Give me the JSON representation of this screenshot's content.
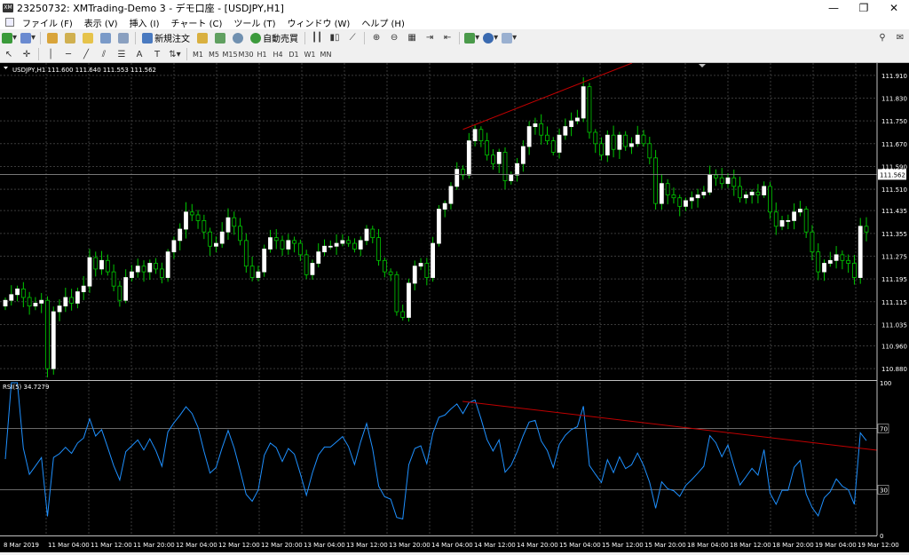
{
  "window": {
    "title": "23250732: XMTrading-Demo 3 - デモ口座 - [USDJPY,H1]",
    "app_icon_label": "XM"
  },
  "menu": {
    "items": [
      "ファイル (F)",
      "表示 (V)",
      "挿入 (I)",
      "チャート (C)",
      "ツール (T)",
      "ウィンドウ (W)",
      "ヘルプ (H)"
    ]
  },
  "toolbar": {
    "new_order_label": "新規注文",
    "auto_trading_label": "自動売買",
    "timeframes": [
      "M1",
      "M5",
      "M15",
      "M30",
      "H1",
      "H4",
      "D1",
      "W1",
      "MN"
    ]
  },
  "chart": {
    "header": "USDJPY,H1  111.600 111.640 111.553 111.562",
    "price_ticks": [
      "111.910",
      "111.830",
      "111.750",
      "111.670",
      "111.590",
      "111.510",
      "111.435",
      "111.355",
      "111.275",
      "111.195",
      "111.115",
      "111.035",
      "110.960",
      "110.880"
    ],
    "current_price": "111.562",
    "time_labels": [
      "8 Mar 2019",
      "11 Mar 04:00",
      "11 Mar 12:00",
      "11 Mar 20:00",
      "12 Mar 04:00",
      "12 Mar 12:00",
      "12 Mar 20:00",
      "13 Mar 04:00",
      "13 Mar 12:00",
      "13 Mar 20:00",
      "14 Mar 04:00",
      "14 Mar 12:00",
      "14 Mar 20:00",
      "15 Mar 04:00",
      "15 Mar 12:00",
      "15 Mar 20:00",
      "18 Mar 04:00",
      "18 Mar 12:00",
      "18 Mar 20:00",
      "19 Mar 04:00",
      "19 Mar 12:00"
    ],
    "colors": {
      "bull": "#ffffff",
      "bear": "#000000",
      "wick": "#00c800",
      "trendline": "#c00000",
      "rsi": "#1e90ff",
      "grid": "#3a3a3a"
    }
  },
  "rsi": {
    "label": "RSI(5) 34.7279",
    "levels": [
      "100",
      "70",
      "30",
      "0"
    ]
  },
  "chart_data": {
    "type": "candlestick",
    "symbol": "USDJPY",
    "timeframe": "H1",
    "y_range": [
      110.84,
      111.95
    ],
    "close": [
      111.12,
      111.14,
      111.16,
      111.13,
      111.1,
      111.11,
      111.12,
      110.88,
      111.08,
      111.1,
      111.13,
      111.11,
      111.15,
      111.17,
      111.27,
      111.23,
      111.26,
      111.22,
      111.17,
      111.12,
      111.2,
      111.22,
      111.24,
      111.22,
      111.25,
      111.23,
      111.2,
      111.29,
      111.33,
      111.37,
      111.43,
      111.42,
      111.4,
      111.36,
      111.31,
      111.32,
      111.36,
      111.41,
      111.38,
      111.33,
      111.24,
      111.2,
      111.22,
      111.3,
      111.34,
      111.33,
      111.3,
      111.33,
      111.32,
      111.28,
      111.21,
      111.25,
      111.29,
      111.31,
      111.31,
      111.32,
      111.33,
      111.32,
      111.3,
      111.33,
      111.37,
      111.34,
      111.26,
      111.22,
      111.21,
      111.08,
      111.06,
      111.18,
      111.24,
      111.25,
      111.2,
      111.32,
      111.44,
      111.46,
      111.52,
      111.58,
      111.56,
      111.68,
      111.72,
      111.68,
      111.63,
      111.6,
      111.64,
      111.54,
      111.56,
      111.6,
      111.66,
      111.73,
      111.74,
      111.7,
      111.68,
      111.64,
      111.7,
      111.73,
      111.75,
      111.76,
      111.87,
      111.71,
      111.67,
      111.63,
      111.7,
      111.65,
      111.7,
      111.66,
      111.67,
      111.7,
      111.67,
      111.62,
      111.46,
      111.53,
      111.49,
      111.48,
      111.45,
      111.47,
      111.48,
      111.49,
      111.5,
      111.56,
      111.55,
      111.53,
      111.55,
      111.52,
      111.48,
      111.49,
      111.5,
      111.49,
      111.52,
      111.43,
      111.38,
      111.4,
      111.4,
      111.43,
      111.44,
      111.36,
      111.29,
      111.22,
      111.25,
      111.26,
      111.28,
      111.26,
      111.25,
      111.2,
      111.38,
      111.36
    ]
  }
}
